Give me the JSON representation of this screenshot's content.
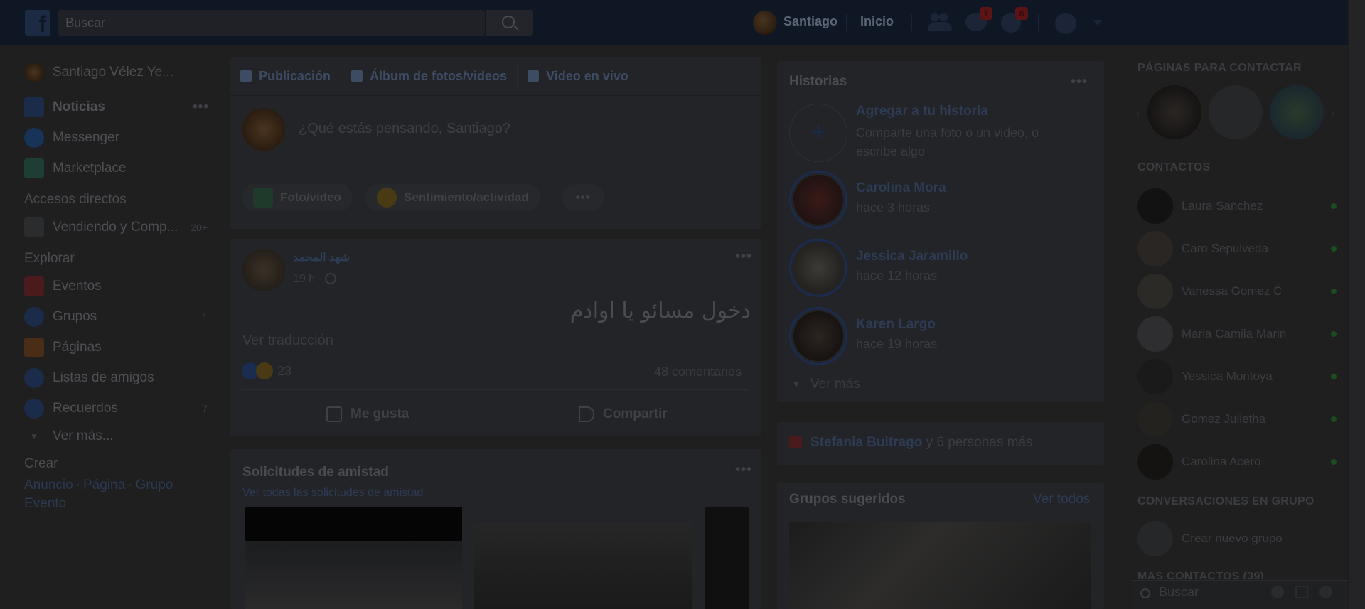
{
  "topbar": {
    "logo": "f",
    "search_placeholder": "Buscar",
    "user_name": "Santiago",
    "home": "Inicio",
    "friend_requests_badge": "",
    "messages_badge": "1",
    "notifications_badge": "8"
  },
  "leftnav": {
    "profile_name": "Santiago Vélez Ye...",
    "items": [
      {
        "label": "Noticias"
      },
      {
        "label": "Messenger"
      },
      {
        "label": "Marketplace"
      }
    ],
    "shortcuts_title": "Accesos directos",
    "shortcuts": [
      {
        "label": "Vendiendo y Comp...",
        "count": "20+"
      }
    ],
    "explore_title": "Explorar",
    "explore": [
      {
        "label": "Eventos",
        "count": ""
      },
      {
        "label": "Grupos",
        "count": "1"
      },
      {
        "label": "Páginas",
        "count": ""
      },
      {
        "label": "Listas de amigos",
        "count": ""
      },
      {
        "label": "Recuerdos",
        "count": "7"
      }
    ],
    "see_more": "Ver más...",
    "create_title": "Crear",
    "create_links": [
      "Anuncio",
      "Página",
      "Grupo",
      "Evento"
    ]
  },
  "composer": {
    "tabs": [
      "Publicación",
      "Álbum de fotos/videos",
      "Video en vivo"
    ],
    "prompt": "¿Qué estás pensando, Santiago?",
    "actions": [
      "Foto/video",
      "Sentimiento/actividad"
    ]
  },
  "post": {
    "author": "شهد المحمد",
    "time": "19 h · ",
    "text": "دخول مسائو يا اوادم",
    "translate": "Ver traducción",
    "reactions_count": "23",
    "comments": "48 comentarios",
    "like": "Me gusta",
    "share": "Compartir"
  },
  "friend_requests": {
    "title": "Solicitudes de amistad",
    "see_all": "Ver todas las solicitudes de amistad"
  },
  "stories": {
    "title": "Historias",
    "add_title": "Agregar a tu historia",
    "add_sub": "Comparte una foto o un video, o escribe algo",
    "items": [
      {
        "name": "Carolina Mora",
        "time": "hace 3 horas"
      },
      {
        "name": "Jessica Jaramillo",
        "time": "hace 12 horas"
      },
      {
        "name": "Karen Largo",
        "time": "hace 19 horas"
      }
    ],
    "see_more": "Ver más"
  },
  "birthday": {
    "name": "Stefania Buitrago",
    "rest": " y 6 personas más"
  },
  "groups": {
    "title": "Grupos sugeridos",
    "see_all": "Ver todos"
  },
  "rightrail": {
    "pages_title": "PÁGINAS PARA CONTACTAR",
    "contacts_title": "CONTACTOS",
    "contacts": [
      "Laura Sanchez",
      "Caro Sepulveda",
      "Vanessa Gomez C",
      "Maria Camila Marin",
      "Yessica Montoya",
      "Gomez Julietha",
      "Carolina Acero"
    ],
    "group_conv_title": "CONVERSACIONES EN GRUPO",
    "new_group": "Crear nuevo grupo",
    "more_contacts": "MÁS CONTACTOS (39)",
    "search_placeholder": "Buscar"
  }
}
